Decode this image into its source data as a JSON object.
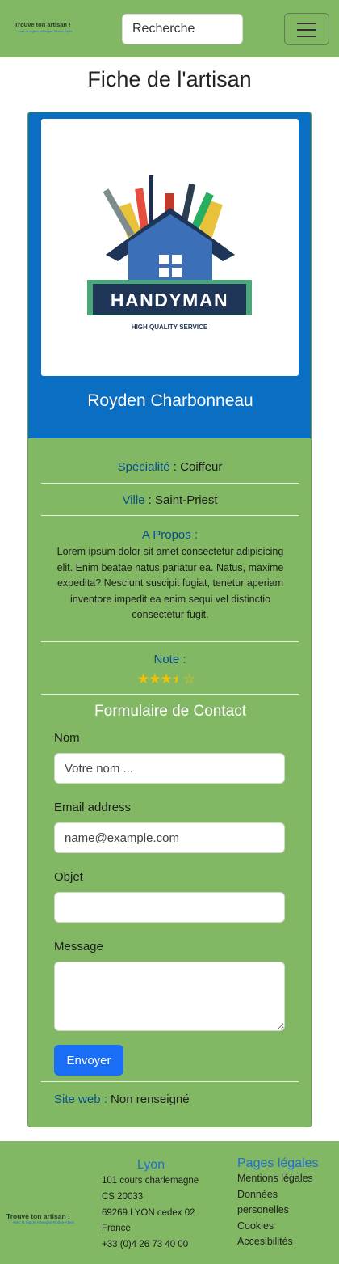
{
  "header": {
    "logo_title": "Trouve ton artisan !",
    "logo_tagline": "Avec la région Auvergne-Rhône-Alpes",
    "search_placeholder": "Recherche"
  },
  "page": {
    "title": "Fiche de l'artisan"
  },
  "artisan": {
    "image_title": "HANDYMAN",
    "image_subtitle": "HIGH QUALITY SERVICE",
    "name": "Royden Charbonneau",
    "specialite_label": "Spécialité",
    "specialite_value": "Coiffeur",
    "ville_label": "Ville",
    "ville_value": "Saint-Priest",
    "about_label": "A Propos :",
    "about_text": "Lorem ipsum dolor sit amet consectetur adipisicing elit. Enim beatae natus pariatur ea. Natus, maxime expedita? Nesciunt suscipit fugiat, tenetur aperiam inventore impedit ea enim sequi vel distinctio consectetur fugit.",
    "note_label": "Note :",
    "rating": 3.5,
    "rating_max": 5,
    "site_label": "Site web :",
    "site_value": "Non renseigné"
  },
  "form": {
    "title": "Formulaire de Contact",
    "nom_label": "Nom",
    "nom_placeholder": "Votre nom ...",
    "email_label": "Email address",
    "email_placeholder": "name@example.com",
    "objet_label": "Objet",
    "message_label": "Message",
    "submit_label": "Envoyer"
  },
  "footer": {
    "logo_title": "Trouve ton artisan !",
    "logo_tagline": "Avec la région Auvergne-Rhône-Alpes",
    "city": "Lyon",
    "address_lines": [
      "101 cours charlemagne",
      "CS 20033",
      "69269 LYON cedex 02",
      "France",
      "+33 (0)4 26 73 40 00"
    ],
    "legal_title": "Pages légales",
    "legal_links": [
      "Mentions légales",
      "Données",
      "personelles",
      "Cookies",
      "Accesibilités"
    ]
  },
  "colors": {
    "green": "#82b864",
    "blue": "#0a6ec3",
    "link_blue": "#1f6fd1",
    "button_blue": "#1a6ef5"
  }
}
